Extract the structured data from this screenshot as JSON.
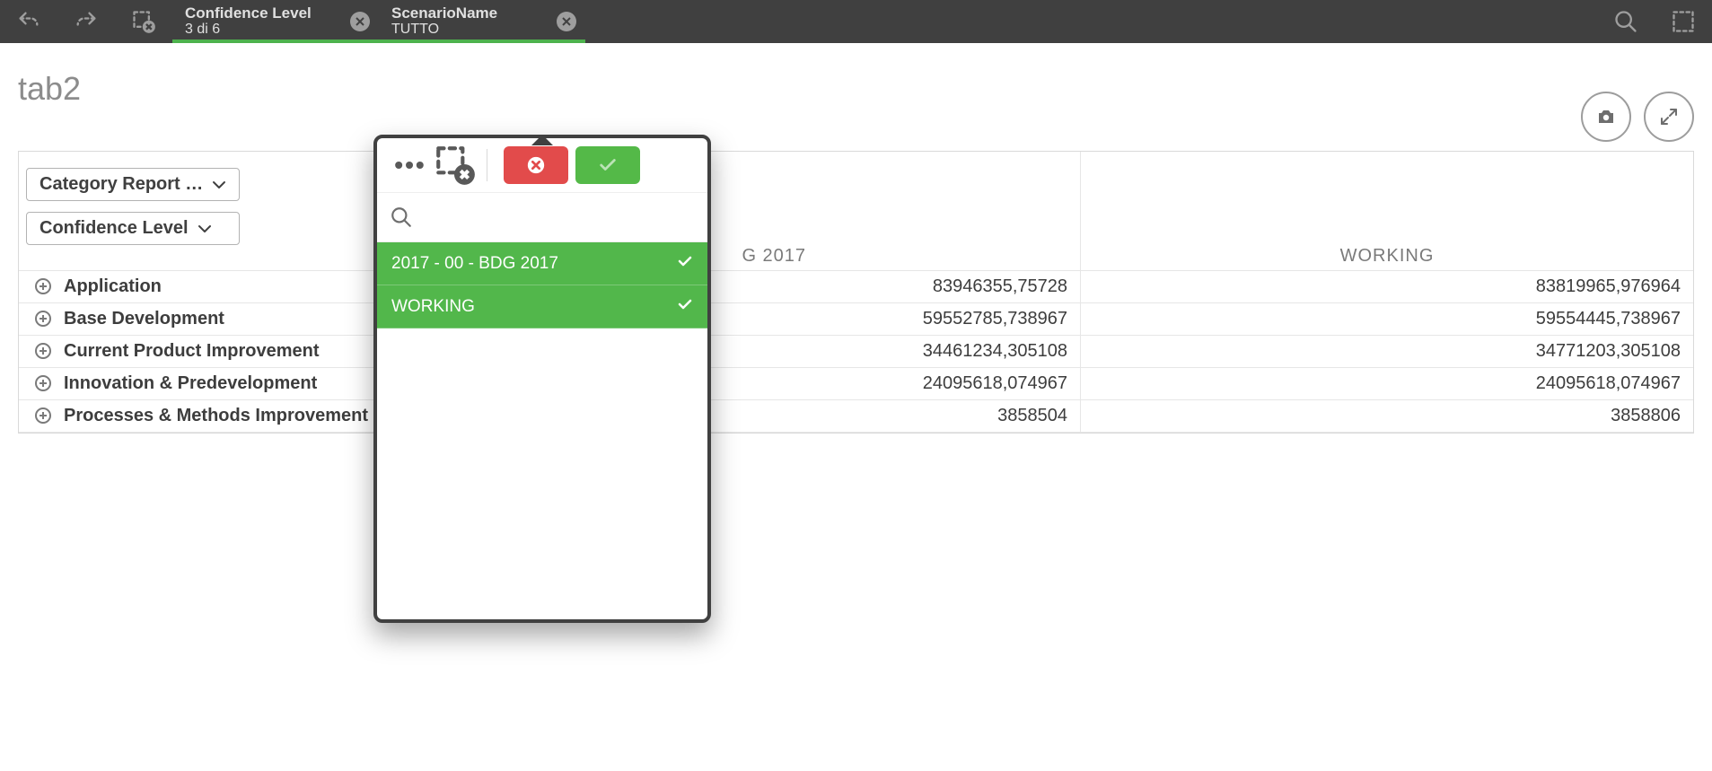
{
  "topbar": {
    "filters": [
      {
        "title": "Confidence Level",
        "value": "3 di 6"
      },
      {
        "title": "ScenarioName",
        "value": "TUTTO"
      }
    ]
  },
  "page": {
    "title": "tab2"
  },
  "dimensions": {
    "pill1": "Category Report …",
    "pill2": "Confidence Level"
  },
  "table": {
    "columns": [
      "",
      "G 2017",
      "WORKING"
    ],
    "rows": [
      {
        "label": "Application",
        "v1": "83946355,75728",
        "v2": "83819965,976964"
      },
      {
        "label": "Base Development",
        "v1": "59552785,738967",
        "v2": "59554445,738967"
      },
      {
        "label": "Current Product Improvement",
        "v1": "34461234,305108",
        "v2": "34771203,305108"
      },
      {
        "label": "Innovation & Predevelopment",
        "v1": "24095618,074967",
        "v2": "24095618,074967"
      },
      {
        "label": "Processes & Methods Improvement",
        "v1": "3858504",
        "v2": "3858806"
      }
    ]
  },
  "popover": {
    "search_placeholder": "",
    "items": [
      {
        "label": "2017 - 00 - BDG 2017",
        "selected": true
      },
      {
        "label": "WORKING",
        "selected": true
      }
    ]
  }
}
